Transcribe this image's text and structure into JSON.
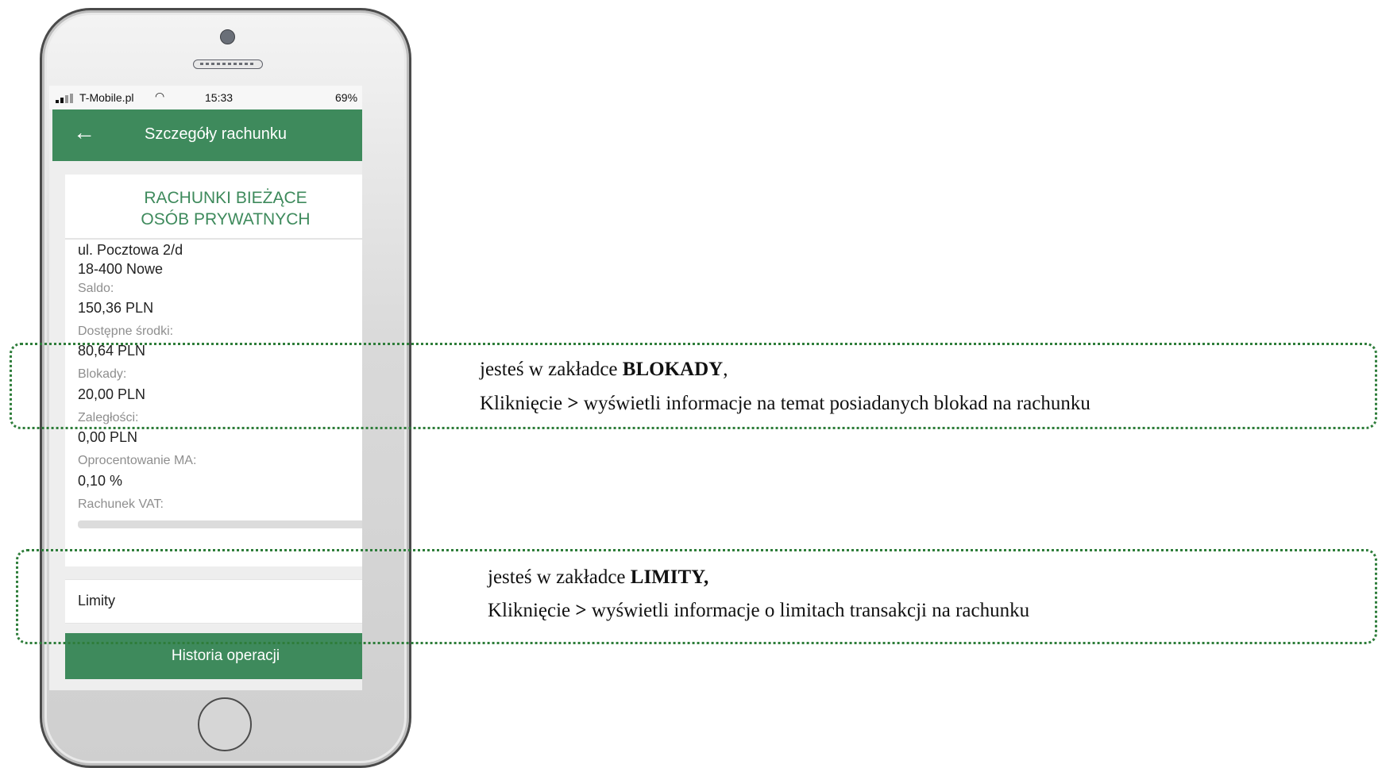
{
  "statusbar": {
    "carrier": "T-Mobile.pl",
    "time": "15:33",
    "battery": "69%"
  },
  "appbar": {
    "back_icon": "arrow-left-icon",
    "title": "Szczegóły rachunku"
  },
  "account": {
    "type_line1": "RACHUNKI BIEŻĄCE",
    "type_line2": "OSÓB PRYWATNYCH",
    "address_line1": "ul. Pocztowa 2/d",
    "address_line2": "18-400 Nowe",
    "fields": [
      {
        "label": "Saldo:",
        "value": "150,36 PLN"
      },
      {
        "label": "Dostępne środki:",
        "value": "80,64 PLN"
      },
      {
        "label": "Blokady:",
        "value": "20,00 PLN"
      },
      {
        "label": "Zaległości:",
        "value": "0,00 PLN"
      },
      {
        "label": "Oprocentowanie MA:",
        "value": "0,10 %"
      },
      {
        "label": "Rachunek VAT:",
        "value": ""
      }
    ]
  },
  "limity_label": "Limity",
  "history_button": "Historia operacji",
  "callouts": {
    "blokady": {
      "line1_prefix": "jesteś w zakładce ",
      "line1_bold": "BLOKADY",
      "line1_suffix": ",",
      "line2_prefix": "Kliknięcie ",
      "line2_bold": ">",
      "line2_suffix": " wyświetli informacje na temat posiadanych blokad na rachunku"
    },
    "limity": {
      "line1_prefix": "jesteś w zakładce ",
      "line1_bold": "LIMITY,",
      "line2_prefix": "Kliknięcie ",
      "line2_bold": ">",
      "line2_suffix": " wyświetli informacje o limitach transakcji na rachunku"
    }
  },
  "colors": {
    "brand_green": "#3e8a5c",
    "callout_border": "#2e7d3a"
  }
}
